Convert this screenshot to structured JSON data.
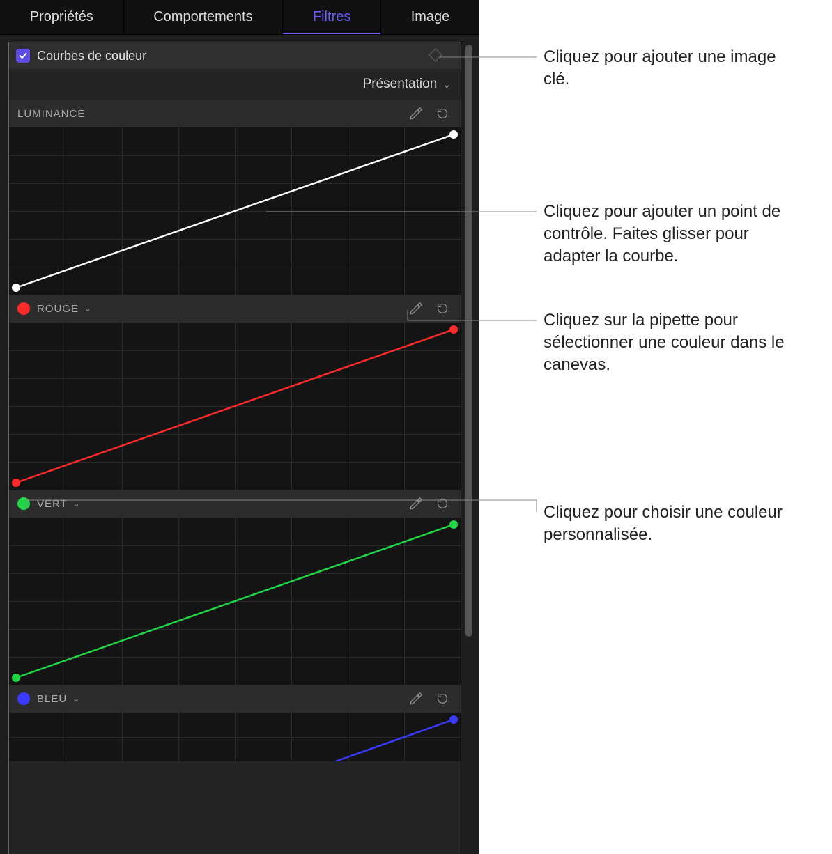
{
  "tabs": {
    "properties": "Propriétés",
    "behaviors": "Comportements",
    "filters": "Filtres",
    "image": "Image",
    "active": "filters"
  },
  "filter": {
    "title": "Courbes de couleur",
    "enabled": true,
    "view_dropdown": "Présentation"
  },
  "curves": {
    "luminance": {
      "label": "LUMINANCE",
      "color": "#ffffff"
    },
    "red": {
      "label": "ROUGE",
      "color": "#ff2b2b"
    },
    "green": {
      "label": "VERT",
      "color": "#1fd644"
    },
    "blue": {
      "label": "BLEU",
      "color": "#3a3aff"
    }
  },
  "callouts": {
    "keyframe": "Cliquez pour ajouter une image clé.",
    "control_point": "Cliquez pour ajouter un point de contrôle. Faites glisser pour adapter la courbe.",
    "eyedropper": "Cliquez sur la pipette pour sélectionner une couleur dans le canevas.",
    "custom_color": "Cliquez pour choisir une couleur personnalisée."
  }
}
